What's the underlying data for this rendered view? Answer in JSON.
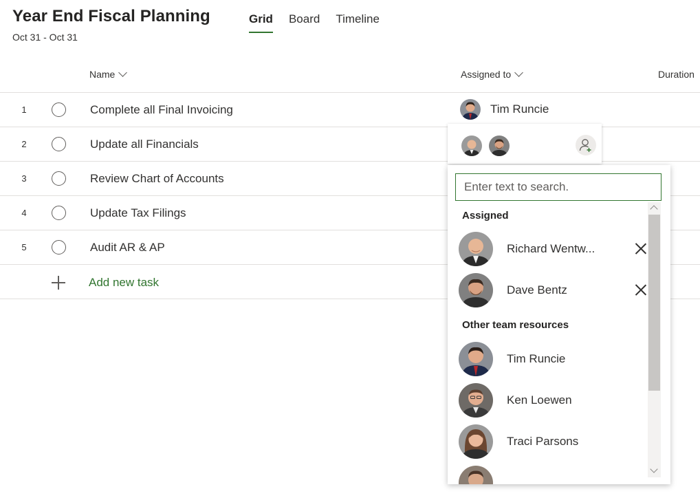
{
  "plan": {
    "title": "Year End Fiscal Planning",
    "dates": "Oct 31 - Oct 31"
  },
  "tabs": [
    {
      "label": "Grid",
      "active": true
    },
    {
      "label": "Board",
      "active": false
    },
    {
      "label": "Timeline",
      "active": false
    }
  ],
  "columns": {
    "name": "Name",
    "assigned_to": "Assigned to",
    "duration": "Duration"
  },
  "tasks": [
    {
      "num": "1",
      "name": "Complete all Final Invoicing",
      "assignee": "Tim Runcie"
    },
    {
      "num": "2",
      "name": "Update all Financials",
      "assignee": ""
    },
    {
      "num": "3",
      "name": "Review Chart of Accounts",
      "assignee": ""
    },
    {
      "num": "4",
      "name": "Update Tax Filings",
      "assignee": ""
    },
    {
      "num": "5",
      "name": "Audit AR & AP",
      "assignee": ""
    }
  ],
  "add_task": {
    "label": "Add new task"
  },
  "picker": {
    "search_placeholder": "Enter text to search.",
    "assigned_title": "Assigned",
    "assigned": [
      {
        "name": "Richard Wentw..."
      },
      {
        "name": "Dave Bentz"
      }
    ],
    "other_title": "Other team resources",
    "others": [
      {
        "name": "Tim Runcie"
      },
      {
        "name": "Ken Loewen"
      },
      {
        "name": "Traci Parsons"
      }
    ]
  },
  "colors": {
    "accent": "#31752f",
    "divider": "#e1dfdd",
    "text": "#323130"
  }
}
